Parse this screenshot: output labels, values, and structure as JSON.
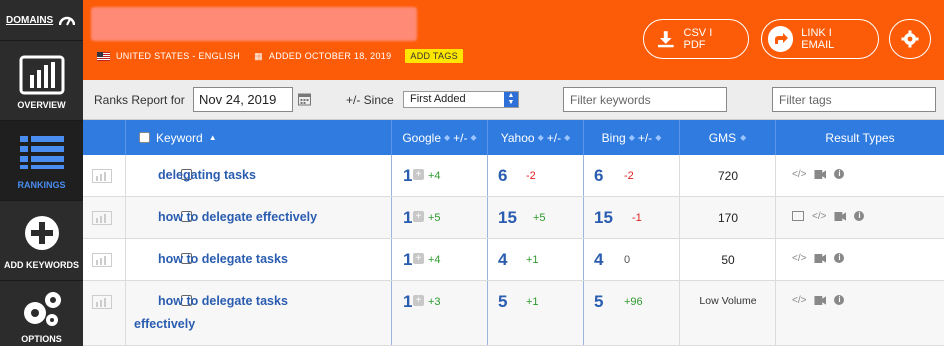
{
  "sidebar": {
    "domains_label": "DOMAINS",
    "items": [
      {
        "label": "OVERVIEW",
        "icon": "bar-chart-icon"
      },
      {
        "label": "RANKINGS",
        "icon": "list-icon",
        "active": true
      },
      {
        "label": "ADD KEYWORDS",
        "icon": "plus-circle-icon"
      },
      {
        "label": "OPTIONS",
        "icon": "gears-icon"
      }
    ]
  },
  "header": {
    "location": "UNITED STATES - ENGLISH",
    "added": "ADDED OCTOBER 18, 2019",
    "add_tags": "ADD TAGS",
    "csv_pdf": "CSV  I  PDF",
    "link_email": "LINK  I  EMAIL",
    "accent_color": "#fc5c07"
  },
  "filters": {
    "ranks_report_label": "Ranks Report for",
    "date_value": "Nov 24, 2019",
    "since_label": "+/- Since",
    "since_selected": "First Added",
    "filter_keywords_placeholder": "Filter keywords",
    "filter_tags_placeholder": "Filter tags"
  },
  "table": {
    "headers": {
      "keyword": "Keyword",
      "google": "Google",
      "yahoo": "Yahoo",
      "bing": "Bing",
      "plusminus": "+/-",
      "gms": "GMS",
      "result_types": "Result Types"
    },
    "rows": [
      {
        "keyword": "delegating tasks",
        "keyword_line2": "",
        "google": "1",
        "google_chg": "+4",
        "yahoo": "6",
        "yahoo_chg": "-2",
        "bing": "6",
        "bing_chg": "-2",
        "gms": "720"
      },
      {
        "keyword": "how to delegate effectively",
        "keyword_line2": "",
        "google": "1",
        "google_chg": "+5",
        "yahoo": "15",
        "yahoo_chg": "+5",
        "bing": "15",
        "bing_chg": "-1",
        "gms": "170"
      },
      {
        "keyword": "how to delegate tasks",
        "keyword_line2": "",
        "google": "1",
        "google_chg": "+4",
        "yahoo": "4",
        "yahoo_chg": "+1",
        "bing": "4",
        "bing_chg": "0",
        "gms": "50"
      },
      {
        "keyword": "how to delegate tasks",
        "keyword_line2": "effectively",
        "google": "1",
        "google_chg": "+3",
        "yahoo": "5",
        "yahoo_chg": "+1",
        "bing": "5",
        "bing_chg": "+96",
        "gms": "Low Volume"
      }
    ]
  }
}
